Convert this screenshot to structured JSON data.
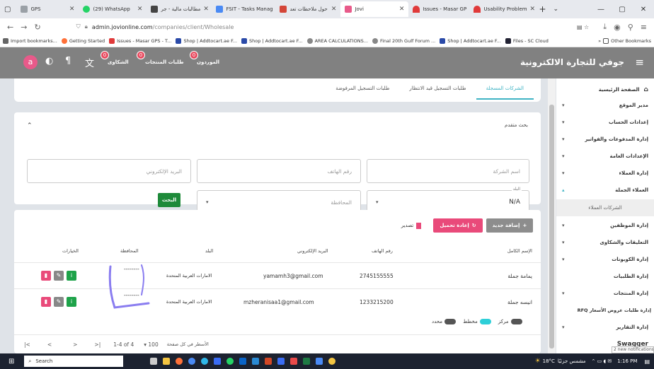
{
  "browser": {
    "tabs": [
      {
        "title": "GPS",
        "color": "#9aa0a6"
      },
      {
        "title": "(29) WhatsApp",
        "color": "#25d366"
      },
      {
        "title": "مطالبات مالية - جر",
        "color": "#444444"
      },
      {
        "title": "FSIT - Tasks Manag",
        "color": "#4a8af4"
      },
      {
        "title": "حول ملاحظات تعد",
        "color": "#d44638"
      },
      {
        "title": "Jovi",
        "color": "#e85a8a"
      },
      {
        "title": "Issues - Masar GP",
        "color": "#e03a3a"
      },
      {
        "title": "Usability Problem",
        "color": "#e03a3a"
      }
    ],
    "url_host": "admin.jovionline.com",
    "url_path": "/companies/client/Wholesale",
    "bookmarks": [
      "Import bookmarks...",
      "Getting Started",
      "Issues - Masar GPS - T...",
      "Shop | Addtocart.ae F...",
      "Shop | Addtocart.ae F...",
      "AREA CALCULATIONS...",
      "Final 20th Gulf Forum ...",
      "Shop | Addtocart.ae F...",
      "Files - SC Cloud"
    ],
    "other_bookmarks": "Other Bookmarks"
  },
  "app": {
    "brand": "جوفي للتجارة الالكترونية",
    "avatar_letter": "a",
    "nav": [
      {
        "label": "الموردون",
        "badge": "0"
      },
      {
        "label": "طلبات المنتجات",
        "badge": "0"
      },
      {
        "label": "الشكاوى",
        "badge": "0"
      }
    ]
  },
  "sidebar": {
    "items": [
      {
        "label": "الصفحة الرئيسية",
        "arrow": "",
        "icon": "home-icon"
      },
      {
        "label": "مدير الموقع",
        "arrow": "▾"
      },
      {
        "label": "إعدادات الحساب",
        "arrow": "▾"
      },
      {
        "label": "إدارة المدفوعات والفواتير",
        "arrow": "▾"
      },
      {
        "label": "الإعدادات العامة",
        "arrow": "▾"
      },
      {
        "label": "إدارة العملاء",
        "arrow": "▾"
      },
      {
        "label": "العملاء الجملة",
        "arrow": "▴"
      },
      {
        "label": "الشركات العملاء",
        "arrow": "",
        "sub": true
      },
      {
        "label": "إدارة الموظفين",
        "arrow": "▾"
      },
      {
        "label": "التعليقات والشكاوى",
        "arrow": "▾"
      },
      {
        "label": "إدارة الكوبونات",
        "arrow": "▾"
      },
      {
        "label": "إدارة الطلبيات",
        "arrow": ""
      },
      {
        "label": "إدارة المنتجات",
        "arrow": "▾"
      },
      {
        "label": "إدارة طلبات عروض الأسعار RFQ",
        "arrow": ""
      },
      {
        "label": "إدارة التقارير",
        "arrow": "▾"
      },
      {
        "label": "Swagger",
        "arrow": ""
      }
    ]
  },
  "tabs": [
    "الشركات المسجلة",
    "طلبات التسجيل قيد الانتظار",
    "طلبات التسجيل المرفوضة"
  ],
  "search": {
    "title": "بحث متقدم",
    "company_placeholder": "اسم الشركة",
    "phone_placeholder": "رقم الهاتف",
    "email_placeholder": "البريد الإلكتروني",
    "country_label": "البلد",
    "country_value": "N/A",
    "governorate_placeholder": "المحافظة",
    "search_button": "البحث"
  },
  "toolbar": {
    "add_new": "إضافة جديد",
    "reload": "إعادة تحميل",
    "export": "تصدير"
  },
  "table": {
    "headers": [
      "الإسم الكامل",
      "رقم الهاتف",
      "البريد الإلكتروني",
      "البلد",
      "المحافظة",
      "الخيارات"
    ],
    "rows": [
      {
        "name": "يمامة جملة",
        "phone": "2745155555",
        "email": "yamamh3@gmail.com",
        "country": "الامارات العربية المتحدة",
        "governorate": "--------"
      },
      {
        "name": "انيسه جملة",
        "phone": "1233215200",
        "email": "mzheranisaa1@gmail.com",
        "country": "الامارات العربية المتحدة",
        "governorate": "--------"
      }
    ]
  },
  "legend": {
    "center": "مركز",
    "planned": "مخطط",
    "selected": "محدد"
  },
  "pagination": {
    "rows_per_page_label": "الأسطر في كل صفحة",
    "rows_per_page": "100",
    "range": "1-4 of 4"
  },
  "taskbar": {
    "search": "Search",
    "weather": "18°C",
    "weather_text": "مشمس جزئيًا",
    "time": "1:16 PM",
    "notifications": "2 new notifications"
  }
}
